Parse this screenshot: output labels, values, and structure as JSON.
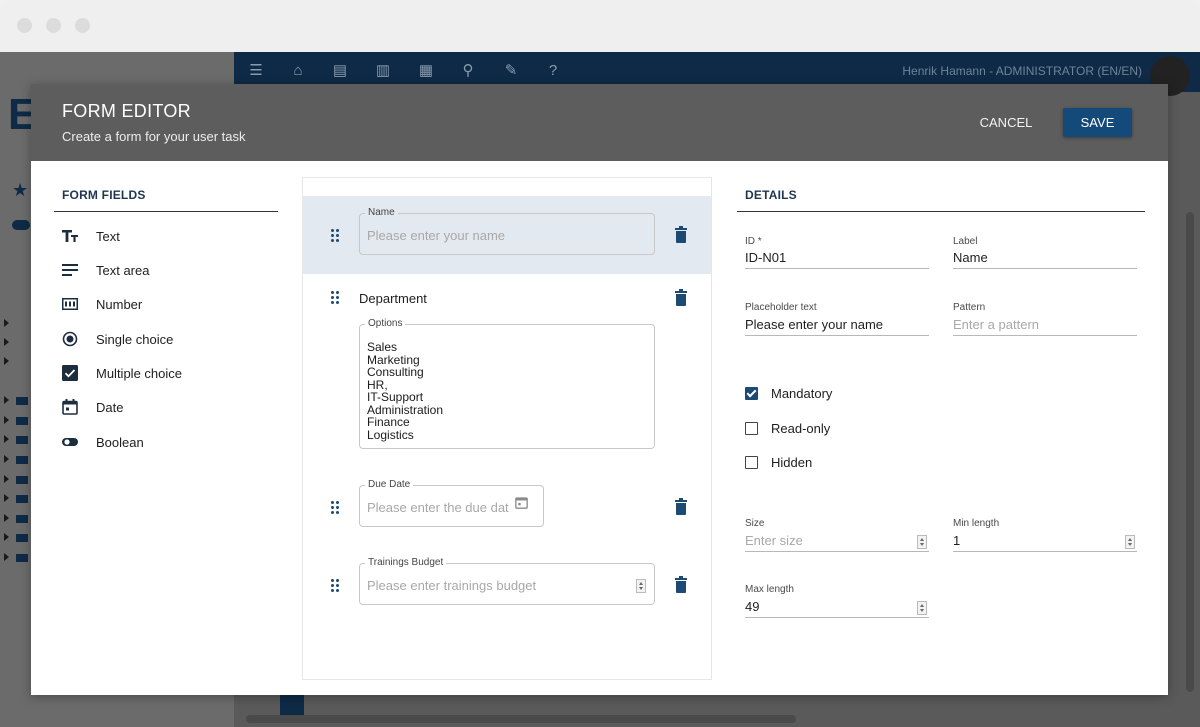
{
  "background": {
    "user": "Henrik Hamann - ADMINISTRATOR (EN/EN)",
    "letter": "E"
  },
  "modal": {
    "title": "FORM EDITOR",
    "subtitle": "Create a form for your user task",
    "cancel_label": "CANCEL",
    "save_label": "SAVE"
  },
  "form_fields": {
    "title": "FORM FIELDS",
    "items": [
      {
        "label": "Text",
        "icon": "text-format-icon"
      },
      {
        "label": "Text area",
        "icon": "text-lines-icon"
      },
      {
        "label": "Number",
        "icon": "number-icon"
      },
      {
        "label": "Single choice",
        "icon": "radio-icon"
      },
      {
        "label": "Multiple choice",
        "icon": "checkbox-icon"
      },
      {
        "label": "Date",
        "icon": "calendar-icon"
      },
      {
        "label": "Boolean",
        "icon": "toggle-icon"
      }
    ]
  },
  "canvas": {
    "name_field": {
      "legend": "Name",
      "placeholder": "Please enter your name"
    },
    "department": {
      "label": "Department",
      "options_legend": "Options",
      "options": [
        "Sales",
        "Marketing",
        "Consulting",
        "HR,",
        "IT-Support",
        "Administration",
        "Finance",
        "Logistics"
      ]
    },
    "due_date": {
      "legend": "Due Date",
      "placeholder": "Please enter the due dat"
    },
    "budget": {
      "legend": "Trainings Budget",
      "placeholder": "Please enter trainings budget"
    }
  },
  "details": {
    "title": "DETAILS",
    "id_label": "ID *",
    "id_value": "ID-N01",
    "label_label": "Label",
    "label_value": "Name",
    "placeholder_label": "Placeholder text",
    "placeholder_value": "Please enter your name",
    "pattern_label": "Pattern",
    "pattern_placeholder": "Enter a pattern",
    "checkboxes": [
      {
        "label": "Mandatory",
        "checked": true
      },
      {
        "label": "Read-only",
        "checked": false
      },
      {
        "label": "Hidden",
        "checked": false
      }
    ],
    "size_label": "Size",
    "size_placeholder": "Enter size",
    "min_length_label": "Min length",
    "min_length_value": "1",
    "max_length_label": "Max length",
    "max_length_value": "49"
  },
  "colors": {
    "accent": "#134a79",
    "header_bg": "#5d5d5d",
    "selected_row": "#e3e9f0"
  }
}
